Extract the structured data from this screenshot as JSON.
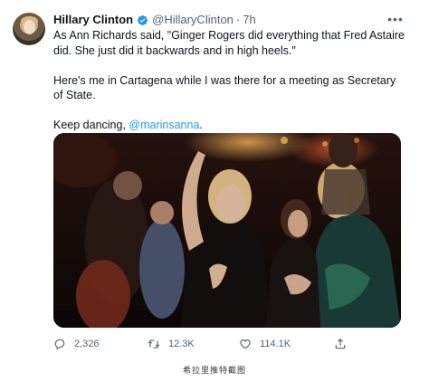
{
  "tweet": {
    "author_name": "Hillary Clinton",
    "handle": "@HillaryClinton",
    "separator": "·",
    "time": "7h",
    "more_label": "•••",
    "body": {
      "line1": "As Ann Richards said, \"Ginger Rogers did everything that Fred Astaire did. She just did it backwards and in high heels.\"",
      "line2": "Here's me in Cartagena while I was there for a meeting as Secretary of State.",
      "line3_prefix": "Keep dancing, ",
      "mention": "@marinsanna",
      "line3_suffix": "."
    },
    "stats": {
      "replies": "2,326",
      "retweets": "12.3K",
      "likes": "114.1K"
    },
    "icons": {
      "verified": "verified-badge-icon",
      "reply": "reply-icon",
      "retweet": "retweet-icon",
      "like": "heart-icon",
      "share": "share-icon",
      "more": "more-icon"
    },
    "colors": {
      "text": "#0f1419",
      "secondary": "#536471",
      "link": "#1d9bf0",
      "verified": "#1d9bf0"
    }
  },
  "caption": "希拉里推特截图"
}
